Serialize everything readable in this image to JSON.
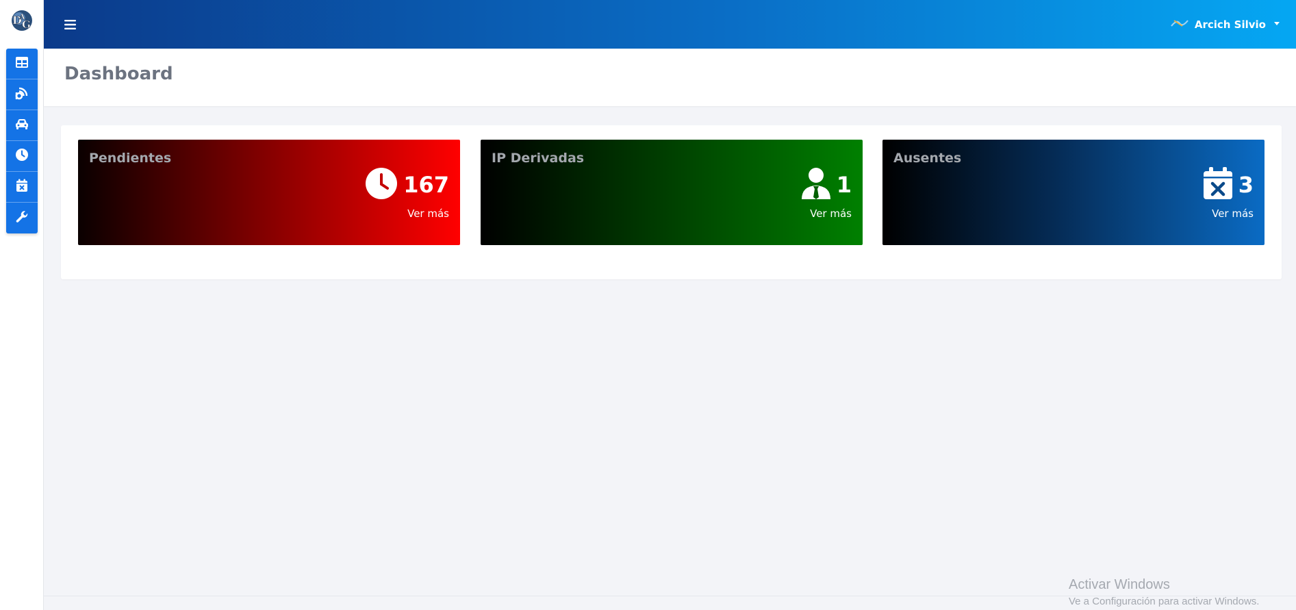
{
  "sidebar": {
    "logo_alt": "DAG",
    "items": [
      {
        "icon": "table-icon"
      },
      {
        "icon": "signal-icon"
      },
      {
        "icon": "car-icon"
      },
      {
        "icon": "clock-icon"
      },
      {
        "icon": "calendar-x-icon"
      },
      {
        "icon": "wrench-icon"
      }
    ]
  },
  "header": {
    "menu_icon": "hamburger-icon",
    "user": "Arcich Silvio"
  },
  "page": {
    "title": "Dashboard"
  },
  "tiles": [
    {
      "title": "Pendientes",
      "value": "167",
      "link": "Ver más",
      "icon": "clock-icon",
      "accent": "#ff0000"
    },
    {
      "title": "IP Derivadas",
      "value": "1",
      "link": "Ver más",
      "icon": "user-tie-icon",
      "accent": "#008000"
    },
    {
      "title": "Ausentes",
      "value": "3",
      "link": "Ver más",
      "icon": "calendar-x-icon",
      "accent": "#0a6bc4"
    }
  ],
  "watermark": {
    "line1": "Activar Windows",
    "line2": "Ve a Configuración para activar Windows."
  },
  "colors": {
    "topbar_start": "#0b3a8a",
    "topbar_end": "#05a7f3",
    "rail_button": "#1473e6"
  }
}
